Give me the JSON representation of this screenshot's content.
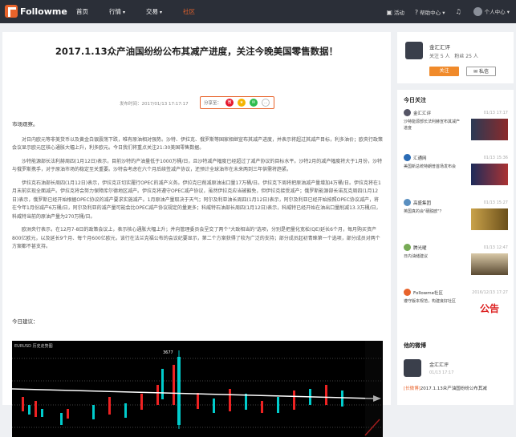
{
  "brand": {
    "name": "Followme",
    "accent": "#e8632b"
  },
  "nav": {
    "items": [
      {
        "label": "首页"
      },
      {
        "label": "行情"
      },
      {
        "label": "交易"
      },
      {
        "label": "社区"
      }
    ]
  },
  "topright": {
    "activity": "活动",
    "help": "帮助中心",
    "user": "个人中心"
  },
  "article": {
    "title": "2017.1.13众产油国纷纷公布其减产进度，关注今晚美国零售数据！",
    "meta": "发布时间：2017/01/13 17:17:17",
    "share_label": "分享至：",
    "intro": "市场观察。",
    "paragraphs": [
      "对日内欧元等非美货币以及黄金白银震荡下跌，唯有原油相对强势。沙特、伊拉克、俄罗斯等国家相继宣布其减产进度，并表示将超过其减产目标，利多油价；欧央行政策会议显示欧元区核心通胀大幅上升，利多欧元。今日我们将重点关注21:30美国零售数据。",
      "沙特能源部长法利赫周四(1月12日)表示，目前沙特的产油量低于1000万桶/日，且沙特减产幅度已经超过了减产协议的目标水平。沙特2月的减产幅度将大于1月份，沙特与俄罗斯携手，对于原油市场的稳定至关重要。沙特会考虑在六个月后续签减产协议，还预计全球油市在未来两到三年供需将趋紧。",
      "伊拉克石油部长周四(1月12日)表示，伊拉克正切实履行OPEC的减产义务。伊拉克已削减原油出口量17万桶/日。伊拉克下周将把原油减产量增加4万桶/日。伊拉克将在1月末前实现全面减产。伊拉克将会努力保障库尔德地区减产。伊拉克将遵守OPEC减产协议，虽然伊拉克应当被豁免，但伊拉克接受减产；俄罗斯能源部长诺瓦克周四(1月12日)表示，俄罗斯已经开始根据OPEC协议的减产要求实施减产。1月原油产量取决于天气；阿尔及利亚油长周四(1月12日)表示，阿尔及利亚已经开始按照OPEC协议减产，将在今年1月份减产6万桶/日，阿尔及利亚的减产量可能会比OPEC减产协议规定的量更多；科威特石油部长周四(1月12日)表示，科威特已经开始在油出口量削减13.3万桶/日，科威特当前的原油产量为270万桶/日。",
      "欧洲央行表示，在12月7-8日的政策会议上，表示核心通胀大幅上升；并向管理委员会呈交了两个\"大致相当的\"选项，分别是把量化宽松(QE)延长6个月，每月购买资产800亿欧元，以及延长9个月、每个月600亿欧元，该行在法兰克福公布的会议纪要显示，第二个方案获得了较为广泛的支持；部分成员起初青睐第一个选项，部分成员对两个方案都不甚支持。"
    ],
    "suggest": "今日建议："
  },
  "chart": {
    "header": "EURUSD 历史走势图",
    "price_high": "3677"
  },
  "profile": {
    "name": "金汇汇评",
    "follow": "关注 5 人",
    "fans": "粉丝 25 人",
    "follow_btn": "关注",
    "msg_btn": "私信"
  },
  "today": {
    "title": "今日关注",
    "items": [
      {
        "author": "金汇汇评",
        "date": "01/13 17:17",
        "text": "沙特能源部长法利赫宣布其减产进度"
      },
      {
        "author": "汇通网",
        "date": "01/13 15:36",
        "text": "美国新总统特朗普首场发布会"
      },
      {
        "author": "高盛集团",
        "date": "01/13 15:27",
        "text": "英国真的会\"硬脱欧\"？"
      },
      {
        "author": "腾光曜",
        "date": "01/13 12:47",
        "text": "日内油储建议"
      },
      {
        "author": "Followme社区",
        "date": "2016/12/13 17:27",
        "text": "遵守版本规范，构建良好社区",
        "img": "公告"
      }
    ]
  },
  "weibo": {
    "title": "他的微博",
    "author": "金汇汇评",
    "date": "01/13 17:17",
    "tag": "[长微博]",
    "text": "2017.1.13众产油国纷纷公布其减"
  }
}
